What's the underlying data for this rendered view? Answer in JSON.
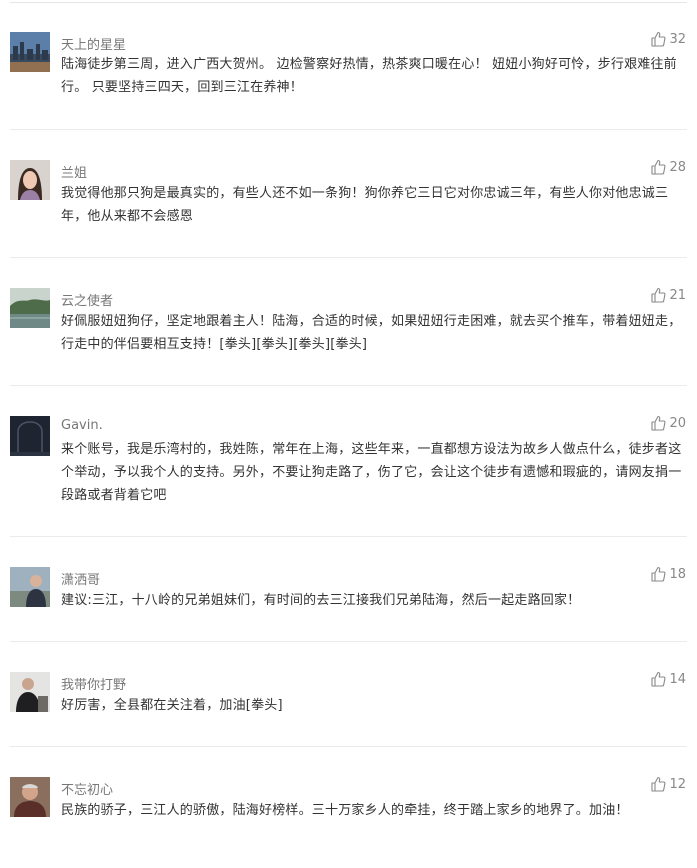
{
  "comments": [
    {
      "user": "天上的星星",
      "likes": "32",
      "text": "陆海徒步第三周，进入广西大贺州。 边检警察好热情，热茶爽口暖在心！ 妞妞小狗好可怜，步行艰难往前行。 只要坚持三四天，回到三江在养神！",
      "avatar": "city-skyline"
    },
    {
      "user": "兰姐",
      "likes": "28",
      "text": "我觉得他那只狗是最真实的，有些人还不如一条狗！狗你养它三日它对你忠诚三年，有些人你对他忠诚三年，他从来都不会感恩",
      "avatar": "woman-portrait"
    },
    {
      "user": "云之使者",
      "likes": "21",
      "text": "好佩服妞妞狗仔，坚定地跟着主人！陆海，合适的时候，如果妞妞行走困难，就去买个推车，带着妞妞走，行走中的伴侣要相互支持！[拳头][拳头][拳头][拳头]",
      "avatar": "landscape"
    },
    {
      "user": "Gavin.",
      "likes": "20",
      "text": "来个账号，我是乐湾村的，我姓陈，常年在上海，这些年来，一直都想方设法为故乡人做点什么，徒步者这个举动，予以我个人的支持。另外，不要让狗走路了，伤了它，会让这个徒步有遗憾和瑕疵的，请网友捐一段路或者背着它吧",
      "avatar": "dark-arch"
    },
    {
      "user": "潇洒哥",
      "likes": "18",
      "text": "建议:三江，十八岭的兄弟姐妹们，有时间的去三江接我们兄弟陆海，然后一起走路回家！",
      "avatar": "man-outdoor"
    },
    {
      "user": "我带你打野",
      "likes": "14",
      "text": "好厉害，全县都在关注着，加油[拳头]",
      "avatar": "man-sitting"
    },
    {
      "user": "不忘初心",
      "likes": "12",
      "text": "民族的骄子，三江人的骄傲，陆海好榜样。三十万家乡人的牵挂，终于踏上家乡的地界了。加油！",
      "avatar": "elder-portrait"
    }
  ]
}
